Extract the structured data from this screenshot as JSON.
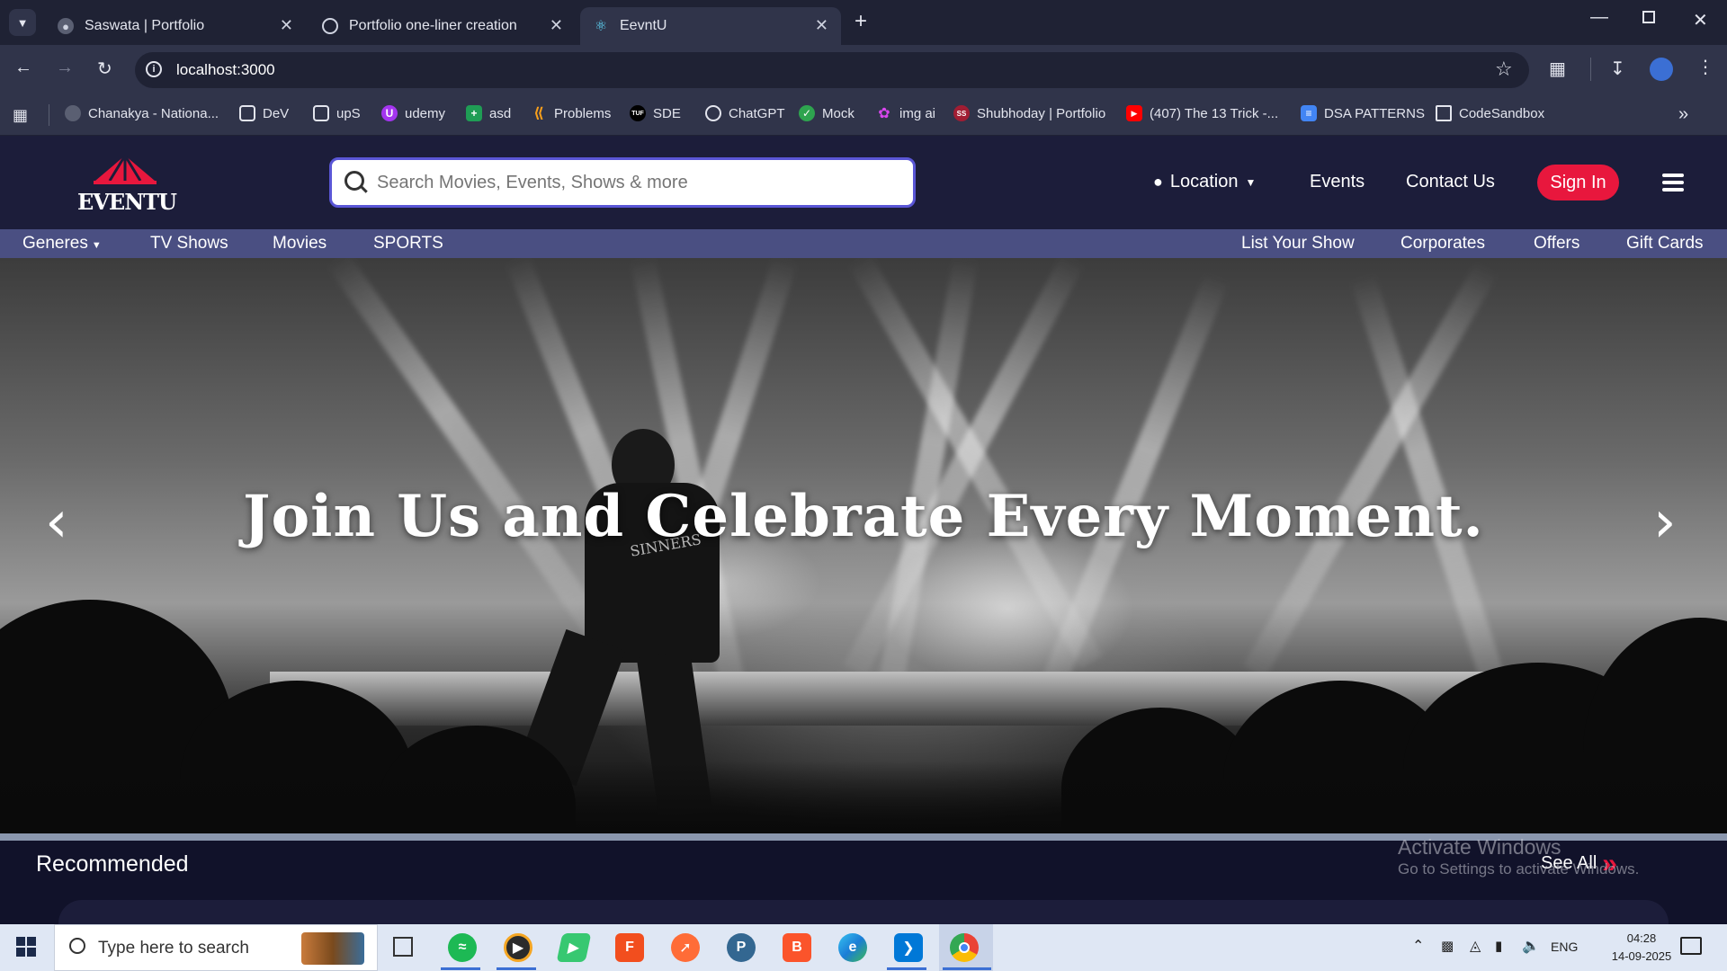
{
  "browser": {
    "tabs": [
      {
        "title": "Saswata | Portfolio",
        "icon": "globe-icon"
      },
      {
        "title": "Portfolio one-liner creation",
        "icon": "chatgpt-icon"
      },
      {
        "title": "EevntU",
        "icon": "react-icon"
      }
    ],
    "url": "localhost:3000",
    "bookmarks": [
      {
        "label": "Chanakya - Nationa...",
        "icon": "globe-icon"
      },
      {
        "label": "DeV",
        "icon": "folder-icon"
      },
      {
        "label": "upS",
        "icon": "folder-icon"
      },
      {
        "label": "udemy",
        "icon": "udemy-icon"
      },
      {
        "label": "asd",
        "icon": "plus-icon"
      },
      {
        "label": "Problems",
        "icon": "leetcode-icon"
      },
      {
        "label": "SDE",
        "icon": "tuf-icon"
      },
      {
        "label": "ChatGPT",
        "icon": "chatgpt-icon"
      },
      {
        "label": "Mock",
        "icon": "check-icon"
      },
      {
        "label": "img ai",
        "icon": "feather-icon"
      },
      {
        "label": "Shubhoday | Portfolio",
        "icon": "ss-icon"
      },
      {
        "label": "(407) The 13 Trick -...",
        "icon": "youtube-icon"
      },
      {
        "label": "DSA PATTERNS",
        "icon": "doc-icon"
      },
      {
        "label": "CodeSandbox",
        "icon": "square-icon"
      }
    ]
  },
  "site": {
    "logo": "EVENTU",
    "search_placeholder": "Search Movies, Events, Shows & more",
    "nav": {
      "location": "Location",
      "events": "Events",
      "contact": "Contact Us",
      "sign_in": "Sign In"
    },
    "subnav_left": [
      "Generes",
      "TV Shows",
      "Movies",
      "SPORTS"
    ],
    "subnav_right": [
      "List Your Show",
      "Corporates",
      "Offers",
      "Gift Cards"
    ],
    "hero_title": "Join Us and Celebrate Every Moment.",
    "hero_shirt": "SINNERS",
    "recommended_title": "Recommended",
    "see_all": "See All"
  },
  "windows": {
    "activate_title": "Activate Windows",
    "activate_sub": "Go to Settings to activate Windows.",
    "search_placeholder": "Type here to search",
    "lang": "ENG",
    "time": "04:28",
    "date": "14-09-2025"
  },
  "colors": {
    "page_bg": "#11122a",
    "navbar_bg": "#1c1d3a",
    "subnav_bg": "#4a4f82",
    "sign_in": "#e8173d",
    "logo_red": "#e8173d",
    "search_border": "#5a56d6"
  }
}
